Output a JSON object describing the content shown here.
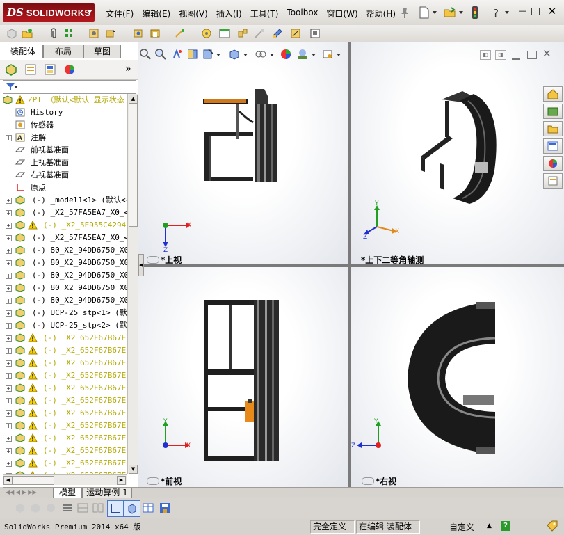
{
  "app": {
    "logo_prefix": "DS",
    "logo_name": "SOLIDWORKS"
  },
  "menu": [
    "文件(F)",
    "编辑(E)",
    "视图(V)",
    "插入(I)",
    "工具(T)",
    "Toolbox",
    "窗口(W)",
    "帮助(H)"
  ],
  "panel_tabs": [
    "装配体",
    "布局",
    "草图"
  ],
  "tree": {
    "root": "ZPT （默认<默认_显示状态",
    "items": [
      {
        "label": "History",
        "icon": "history-icon",
        "expand": false,
        "warn": false,
        "indent": 1
      },
      {
        "label": "传感器",
        "icon": "sensor-icon",
        "expand": false,
        "warn": false,
        "indent": 1
      },
      {
        "label": "注解",
        "icon": "annotation-icon",
        "expand": true,
        "warn": false,
        "indent": 1
      },
      {
        "label": "前视基准面",
        "icon": "plane-icon",
        "expand": false,
        "warn": false,
        "indent": 1
      },
      {
        "label": "上视基准面",
        "icon": "plane-icon",
        "expand": false,
        "warn": false,
        "indent": 1
      },
      {
        "label": "右视基准面",
        "icon": "plane-icon",
        "expand": false,
        "warn": false,
        "indent": 1
      },
      {
        "label": "原点",
        "icon": "origin-icon",
        "expand": false,
        "warn": false,
        "indent": 1
      },
      {
        "label": "(-) _model1<1> (默认<<默",
        "icon": "part-icon",
        "expand": true,
        "warn": false,
        "indent": 1
      },
      {
        "label": "(-) _X2_57FA5EA7_X0_<1>",
        "icon": "part-icon",
        "expand": true,
        "warn": false,
        "indent": 1
      },
      {
        "label": "(-) _X2_5E955C4294DD",
        "icon": "part-icon",
        "expand": true,
        "warn": true,
        "indent": 1
      },
      {
        "label": "(-) _X2_57FA5EA7_X0_<2>",
        "icon": "part-icon",
        "expand": true,
        "warn": false,
        "indent": 1
      },
      {
        "label": "(-) 80_X2_94DD6750_X0_<",
        "icon": "part-icon",
        "expand": true,
        "warn": false,
        "indent": 1
      },
      {
        "label": "(-) 80_X2_94DD6750_X0_<",
        "icon": "part-icon",
        "expand": true,
        "warn": false,
        "indent": 1
      },
      {
        "label": "(-) 80_X2_94DD6750_X0_<",
        "icon": "part-icon",
        "expand": true,
        "warn": false,
        "indent": 1
      },
      {
        "label": "(-) 80_X2_94DD6750_X0_<",
        "icon": "part-icon",
        "expand": true,
        "warn": false,
        "indent": 1
      },
      {
        "label": "(-) 80_X2_94DD6750_X0_<",
        "icon": "part-icon",
        "expand": true,
        "warn": false,
        "indent": 1
      },
      {
        "label": "(-) UCP-25_stp<1> (默认",
        "icon": "part-icon",
        "expand": true,
        "warn": false,
        "indent": 1
      },
      {
        "label": "(-) UCP-25_stp<2> (默认",
        "icon": "part-icon",
        "expand": true,
        "warn": false,
        "indent": 1
      },
      {
        "label": "(-) _X2_652F67B67EC4",
        "icon": "part-icon",
        "expand": true,
        "warn": true,
        "indent": 1
      },
      {
        "label": "(-) _X2_652F67B67EC4",
        "icon": "part-icon",
        "expand": true,
        "warn": true,
        "indent": 1
      },
      {
        "label": "(-) _X2_652F67B67EC4",
        "icon": "part-icon",
        "expand": true,
        "warn": true,
        "indent": 1
      },
      {
        "label": "(-) _X2_652F67B67EC4",
        "icon": "part-icon",
        "expand": true,
        "warn": true,
        "indent": 1
      },
      {
        "label": "(-) _X2_652F67B67EC4",
        "icon": "part-icon",
        "expand": true,
        "warn": true,
        "indent": 1
      },
      {
        "label": "(-) _X2_652F67B67EC4",
        "icon": "part-icon",
        "expand": true,
        "warn": true,
        "indent": 1
      },
      {
        "label": "(-) _X2_652F67B67EC4",
        "icon": "part-icon",
        "expand": true,
        "warn": true,
        "indent": 1
      },
      {
        "label": "(-) _X2_652F67B67EC4",
        "icon": "part-icon",
        "expand": true,
        "warn": true,
        "indent": 1
      },
      {
        "label": "(-) _X2_652F67B67EC4",
        "icon": "part-icon",
        "expand": true,
        "warn": true,
        "indent": 1
      },
      {
        "label": "(-) _X2_652F67B67EC4",
        "icon": "part-icon",
        "expand": true,
        "warn": true,
        "indent": 1
      },
      {
        "label": "(-) _X2_652F67B67EC4",
        "icon": "part-icon",
        "expand": true,
        "warn": true,
        "indent": 1
      },
      {
        "label": "(-) _X2_652F67B67EC4",
        "icon": "part-icon",
        "expand": true,
        "warn": true,
        "indent": 1
      }
    ]
  },
  "viewports": {
    "top_left": "*上视",
    "top_right": "*上下二等角轴测",
    "bottom_left": "*前视",
    "bottom_right": "*右视"
  },
  "axes": {
    "x": "X",
    "y": "Y",
    "z": "Z"
  },
  "bottom_tabs": [
    "模型",
    "运动算例 1"
  ],
  "status": {
    "product": "SolidWorks Premium 2014 x64 版",
    "definition": "完全定义",
    "editing": "在编辑 装配体",
    "units": "自定义"
  },
  "colors": {
    "warning": "#b3a800",
    "logo_red": "#a3151b",
    "axis_x": "#e02020",
    "axis_y": "#20a020",
    "axis_z": "#2030d0"
  }
}
